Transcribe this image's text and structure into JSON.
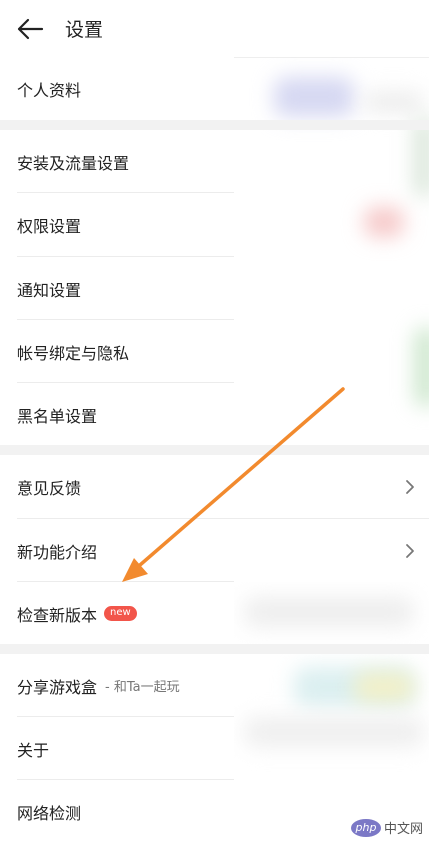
{
  "header": {
    "title": "设置"
  },
  "items": [
    {
      "label": "个人资料"
    },
    {
      "label": "安装及流量设置"
    },
    {
      "label": "权限设置"
    },
    {
      "label": "通知设置"
    },
    {
      "label": "帐号绑定与隐私"
    },
    {
      "label": "黑名单设置"
    },
    {
      "label": "意见反馈"
    },
    {
      "label": "新功能介绍"
    },
    {
      "label": "检查新版本",
      "badge": "new"
    },
    {
      "label": "分享游戏盒",
      "sub": "- 和Ta一起玩"
    },
    {
      "label": "关于"
    },
    {
      "label": "网络检测"
    }
  ],
  "watermark": {
    "logo": "php",
    "text": "中文网"
  },
  "colors": {
    "accent_arrow": "#f28a2e",
    "badge": "#f2554a",
    "section_gap": "#f2f2f2"
  }
}
